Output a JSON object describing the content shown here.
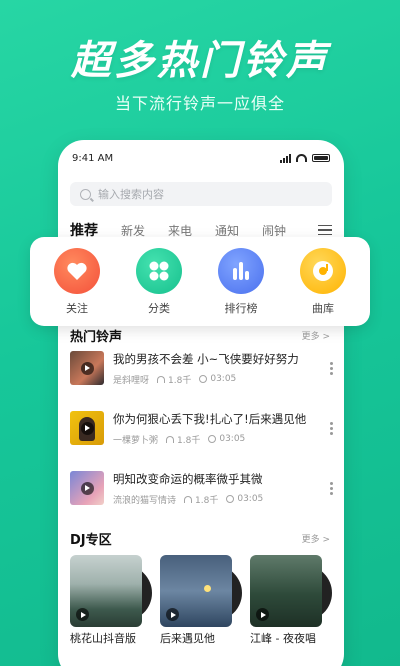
{
  "promo": {
    "headline": "超多热门铃声",
    "subline": "当下流行铃声一应俱全"
  },
  "status_bar": {
    "time": "9:41 AM"
  },
  "search": {
    "placeholder": "输入搜索内容"
  },
  "tabs": [
    {
      "label": "推荐",
      "active": true
    },
    {
      "label": "新发"
    },
    {
      "label": "来电"
    },
    {
      "label": "通知"
    },
    {
      "label": "闹钟"
    }
  ],
  "categories": [
    {
      "label": "关注",
      "icon": "heart-icon",
      "color": "#ff6a4a"
    },
    {
      "label": "分类",
      "icon": "grid-icon",
      "color": "#22cf9c"
    },
    {
      "label": "排行榜",
      "icon": "bar-chart-icon",
      "color": "#5b82f6"
    },
    {
      "label": "曲库",
      "icon": "disc-icon",
      "color": "#ffc21a"
    }
  ],
  "hot": {
    "title": "热门铃声",
    "more": "更多 >",
    "songs": [
      {
        "title": "我的男孩不会差 小~飞侠要好好努力",
        "artist": "是斜哩呀",
        "plays": "1.8千",
        "duration": "03:05"
      },
      {
        "title": "你为何狠心丢下我!扎心了!后来遇见他",
        "artist": "一棵萝卜粥",
        "plays": "1.8千",
        "duration": "03:05"
      },
      {
        "title": "明知改变命运的概率微乎其微",
        "artist": "流浪的猫写情诗",
        "plays": "1.8千",
        "duration": "03:05"
      }
    ]
  },
  "dj": {
    "title": "DJ专区",
    "more": "更多 >",
    "items": [
      {
        "title": "桃花山抖音版"
      },
      {
        "title": "后来遇见他"
      },
      {
        "title": "江峰 - 夜夜唱"
      }
    ]
  }
}
